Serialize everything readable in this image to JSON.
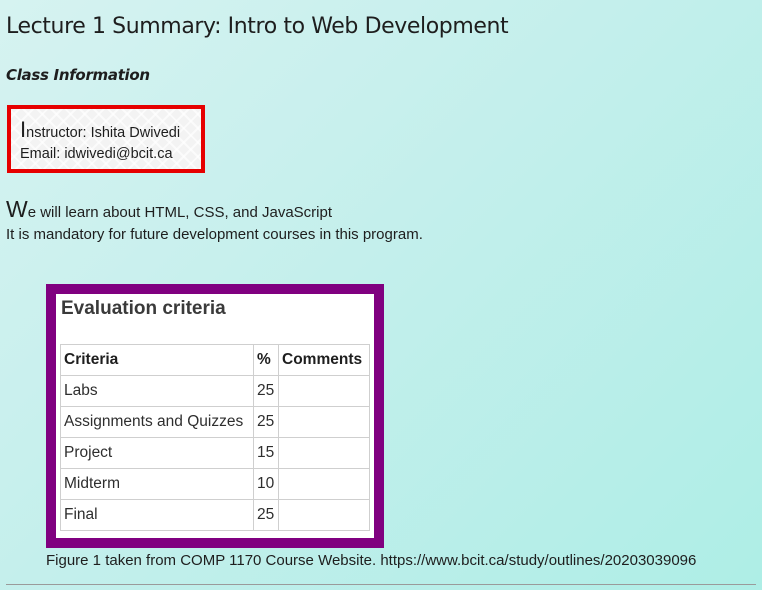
{
  "page": {
    "title": "Lecture 1 Summary: Intro to Web Development",
    "subtitle": "Class Information"
  },
  "info": {
    "instructor_first": "I",
    "instructor_rest": "nstructor: Ishita Dwivedi",
    "email": "Email: idwivedi@bcit.ca"
  },
  "intro": {
    "line1_first": "W",
    "line1_rest": "e will learn about HTML, CSS, and JavaScript",
    "line2": "It is mandatory for future development courses in this program."
  },
  "figure": {
    "heading": "Evaluation criteria",
    "columns": [
      "Criteria",
      "%",
      "Comments"
    ],
    "rows": [
      {
        "criteria": "Labs",
        "percent": "25",
        "comments": ""
      },
      {
        "criteria": "Assignments and Quizzes",
        "percent": "25",
        "comments": ""
      },
      {
        "criteria": "Project",
        "percent": "15",
        "comments": ""
      },
      {
        "criteria": "Midterm",
        "percent": "10",
        "comments": ""
      },
      {
        "criteria": "Final",
        "percent": "25",
        "comments": ""
      }
    ],
    "caption": "Figure 1 taken from COMP 1170 Course Website. https://www.bcit.ca/study/outlines/20203039096"
  },
  "colors": {
    "info_border": "#e60000",
    "figure_border": "#800080",
    "background_start": "#d6f3f1",
    "background_end": "#aeeee6"
  }
}
